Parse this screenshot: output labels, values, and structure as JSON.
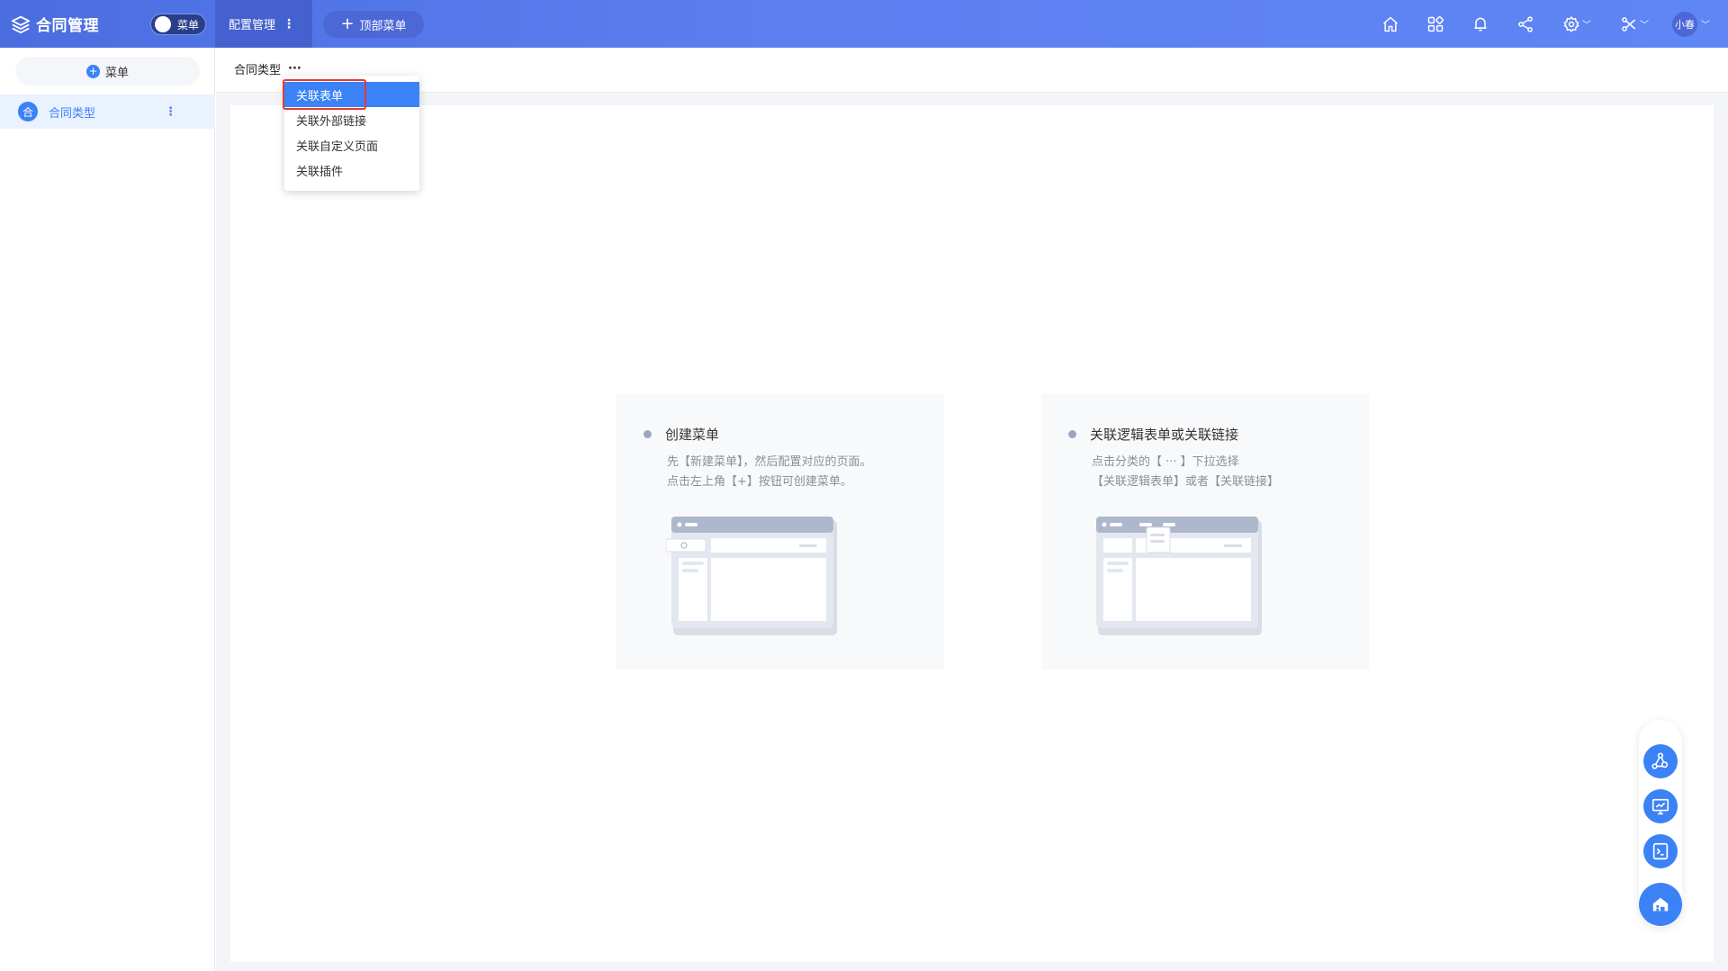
{
  "app": {
    "title": "合同管理",
    "menu_toggle_label": "菜单",
    "config_tab": "配置管理",
    "config_tab_more": "⋮",
    "top_menu_button": "顶部菜单",
    "user_name": "小春"
  },
  "sidebar": {
    "add_menu_label": "菜单",
    "items": [
      {
        "icon_text": "合",
        "label": "合同类型",
        "more": "⋮"
      }
    ]
  },
  "breadcrumb": {
    "title": "合同类型",
    "more": "···"
  },
  "dropdown": {
    "items": [
      "关联表单",
      "关联外部链接",
      "关联自定义页面",
      "关联插件"
    ],
    "highlighted_index": 0
  },
  "cards": [
    {
      "title": "创建菜单",
      "desc_line1": "先【新建菜单】，然后配置对应的页面。",
      "desc_line2": "点击左上角【+】按钮可创建菜单。"
    },
    {
      "title": "关联逻辑表单或关联链接",
      "desc_line1": "点击分类的【 ··· 】下拉选择",
      "desc_line2": "【关联逻辑表单】或者【关联链接】"
    }
  ],
  "icons": {
    "top_bar": [
      "layers-icon",
      "home-icon",
      "apps-grid-icon",
      "bell-icon",
      "share-icon",
      "settings-icon",
      "tools-icon",
      "avatar"
    ],
    "dock": [
      "workflow-icon",
      "screen-chart-icon",
      "terminal-icon",
      "home-building-icon"
    ]
  },
  "colors": {
    "primary": "#3b82f6",
    "topbar_start": "#4a6ee0",
    "topbar_end": "#5f86f5",
    "highlight_border": "#e53935"
  }
}
